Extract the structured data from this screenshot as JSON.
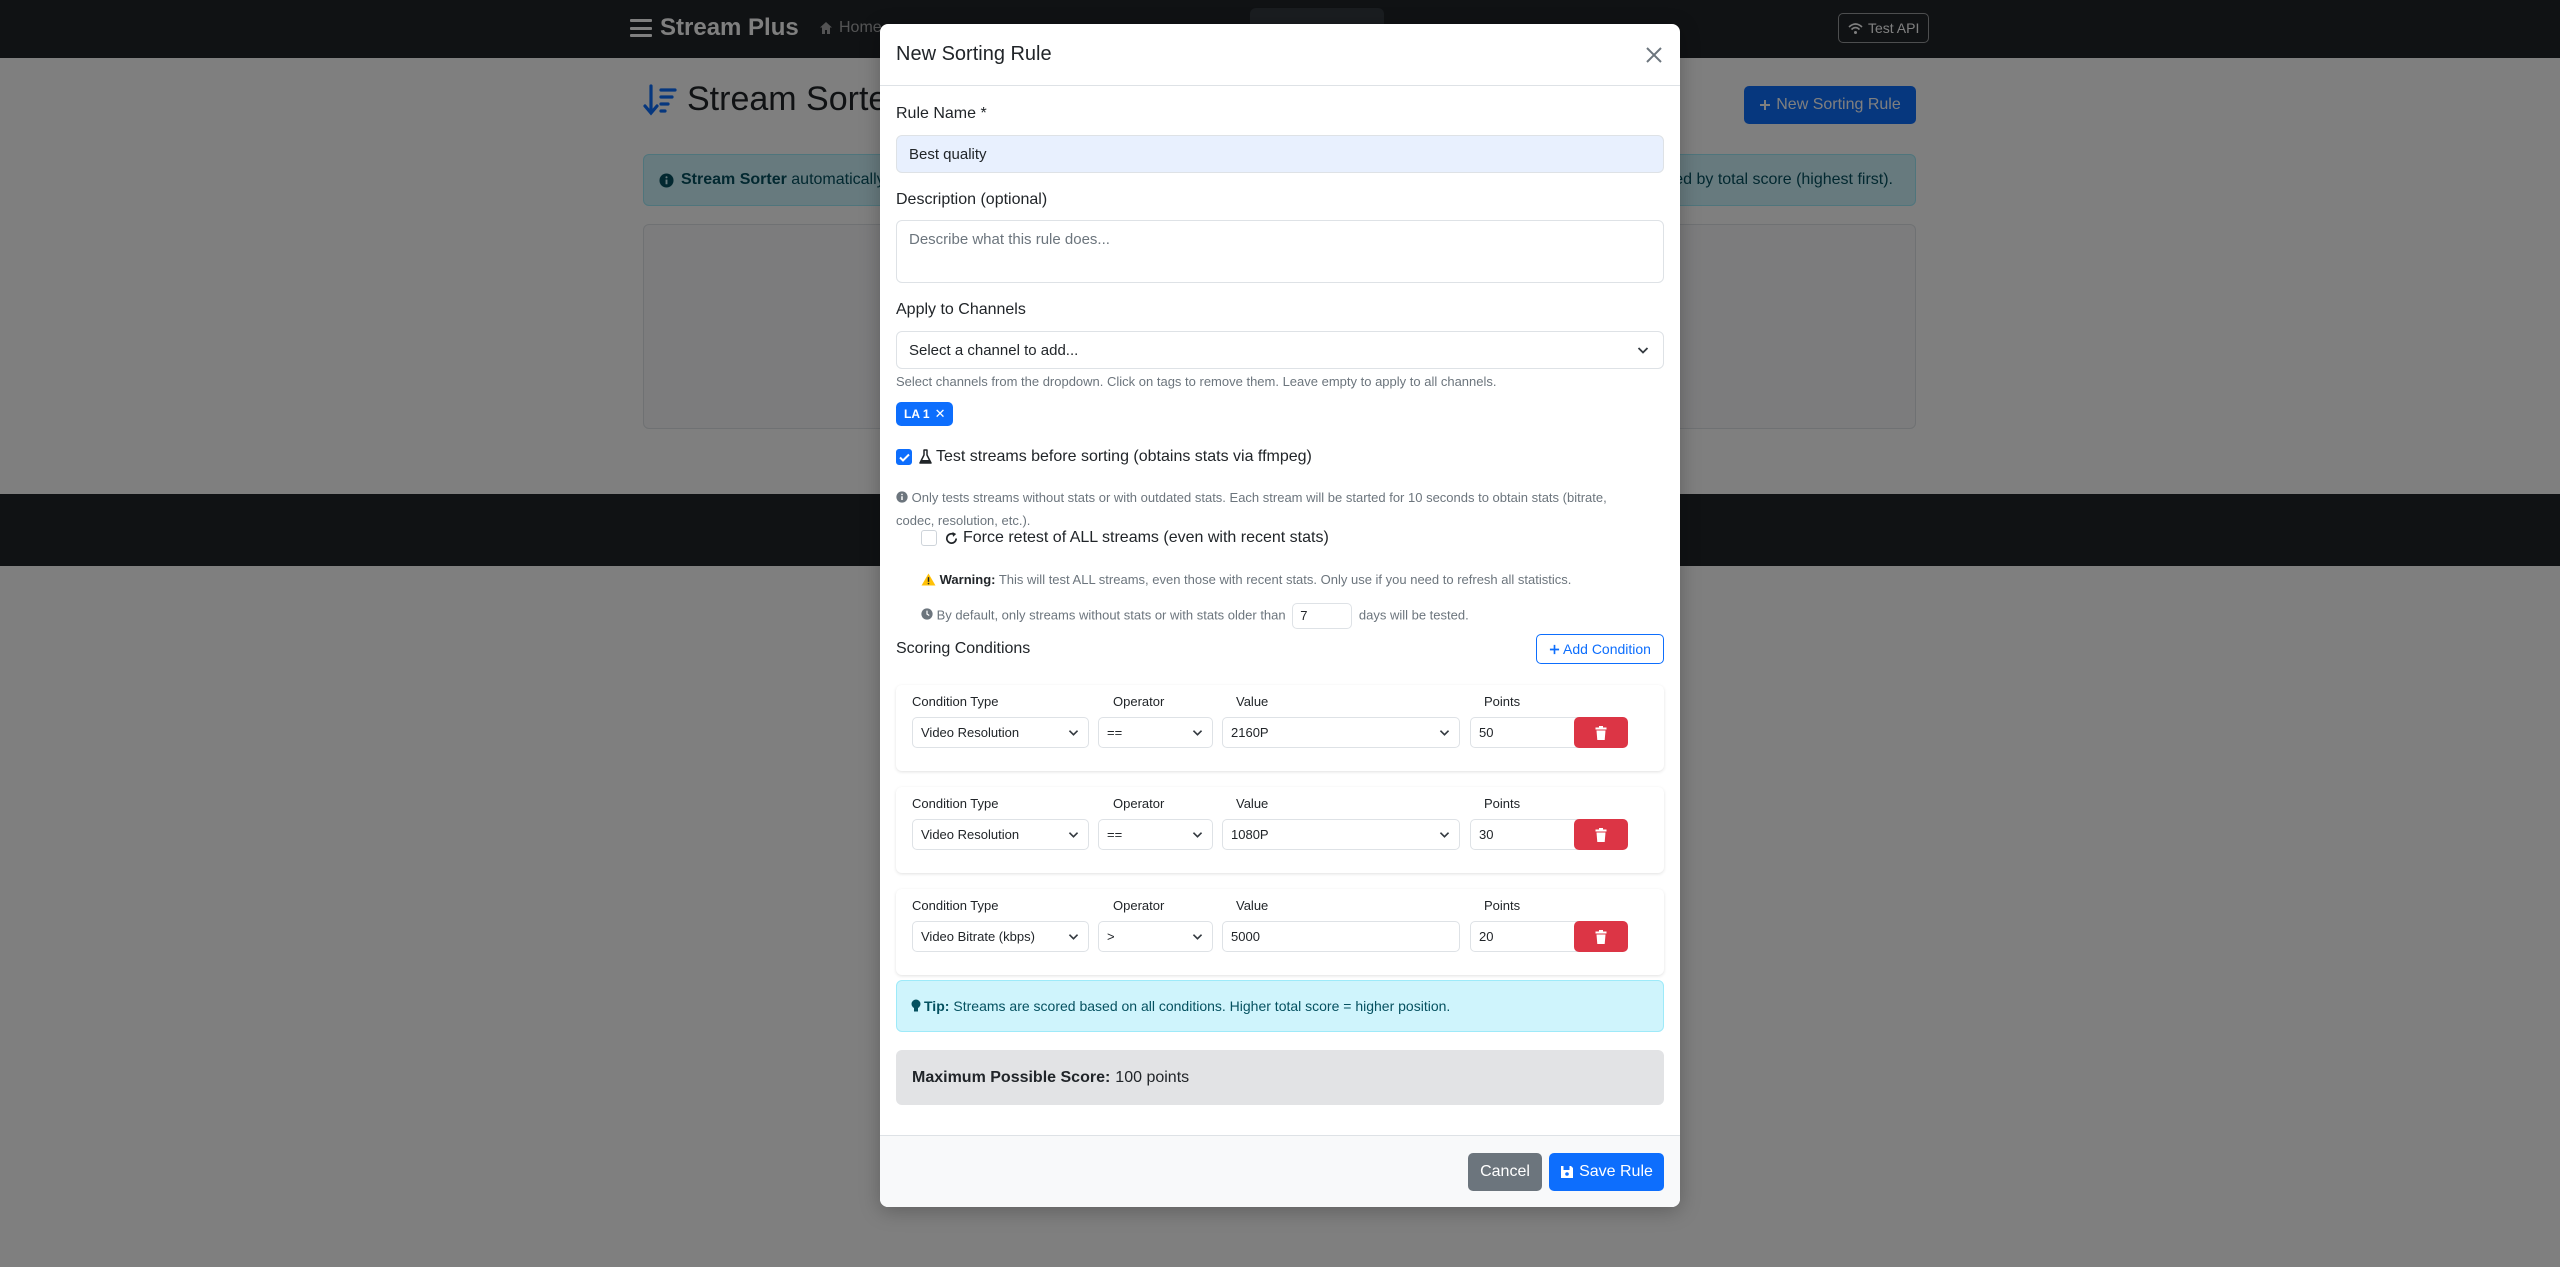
{
  "navbar": {
    "brand": "Stream Plus",
    "home_label": "Home",
    "test_api_label": "Test API"
  },
  "page": {
    "title": "Stream Sorter",
    "new_rule_button": "New Sorting Rule",
    "info_bold": "Stream Sorter",
    "info_text": "automatically",
    "info_text_right": "ed by total score (highest first)."
  },
  "modal": {
    "title": "New Sorting Rule",
    "rule_name": {
      "label": "Rule Name *",
      "value": "Best quality"
    },
    "description": {
      "label": "Description (optional)",
      "placeholder": "Describe what this rule does..."
    },
    "channels": {
      "label": "Apply to Channels",
      "select_placeholder": "Select a channel to add...",
      "help": "Select channels from the dropdown. Click on tags to remove them. Leave empty to apply to all channels.",
      "tags": [
        "LA 1"
      ]
    },
    "test_streams": {
      "label": "Test streams before sorting (obtains stats via ffmpeg)",
      "checked": true,
      "note_line1": "Only tests streams without stats or with outdated stats. Each stream will be started for 10 seconds to obtain stats (bitrate,",
      "note_line2": "codec, resolution, etc.)."
    },
    "force_retest": {
      "label": "Force retest of ALL streams (even with recent stats)",
      "checked": false,
      "warning_bold": "Warning:",
      "warning_text": "This will test ALL streams, even those with recent stats. Only use if you need to refresh all statistics.",
      "default_pre": "By default, only streams without stats or with stats older than",
      "days_value": "7",
      "default_post": "days will be tested."
    },
    "scoring": {
      "label": "Scoring Conditions",
      "add_button": "Add Condition",
      "col_condition": "Condition Type",
      "col_operator": "Operator",
      "col_value": "Value",
      "col_points": "Points",
      "conditions": [
        {
          "type": "Video Resolution",
          "operator": "==",
          "value": "2160P",
          "value_is_select": true,
          "points": "50"
        },
        {
          "type": "Video Resolution",
          "operator": "==",
          "value": "1080P",
          "value_is_select": true,
          "points": "30"
        },
        {
          "type": "Video Bitrate (kbps)",
          "operator": ">",
          "value": "5000",
          "value_is_select": false,
          "points": "20"
        }
      ]
    },
    "tip": {
      "bold": "Tip:",
      "text": "Streams are scored based on all conditions. Higher total score = higher position."
    },
    "max_score": {
      "bold": "Maximum Possible Score:",
      "text": "100 points"
    },
    "footer": {
      "cancel": "Cancel",
      "save": "Save Rule"
    }
  },
  "colors": {
    "primary": "#0d6efd",
    "danger": "#dc3545",
    "secondary": "#6c757d",
    "navbar": "#212529",
    "info_bg": "#cff4fc"
  }
}
